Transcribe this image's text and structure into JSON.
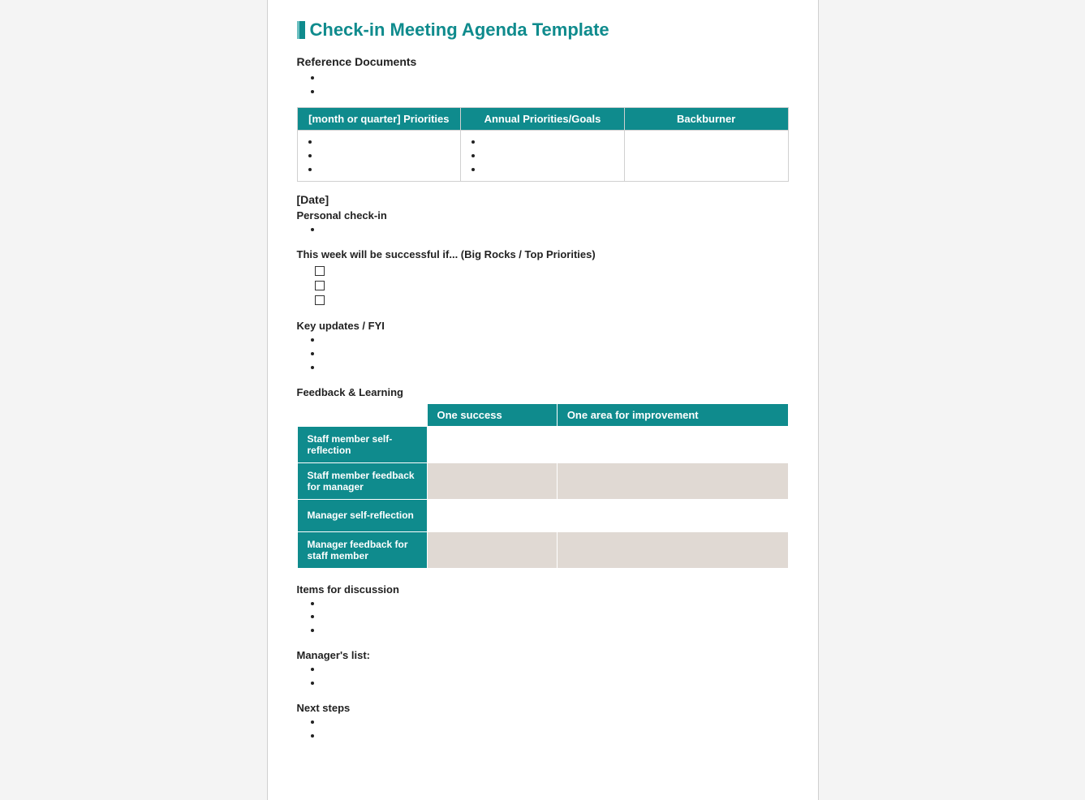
{
  "title": "Check-in Meeting Agenda Template",
  "sections": {
    "reference_docs": "Reference Documents",
    "date": "[Date]",
    "personal_checkin": "Personal check-in",
    "successful_if": "This week will be successful if... (Big Rocks / Top Priorities)",
    "key_updates": "Key updates / FYI",
    "feedback_learning": "Feedback & Learning",
    "items_discussion": "Items for discussion",
    "managers_list": "Manager's list:",
    "next_steps": "Next steps"
  },
  "priorities_table": {
    "headers": [
      "[month or quarter] Priorities",
      "Annual Priorities/Goals",
      "Backburner"
    ]
  },
  "feedback_table": {
    "col_headers": [
      "One success",
      "One area for improvement"
    ],
    "row_headers": [
      "Staff member self-reflection",
      "Staff member feedback for manager",
      "Manager self-reflection",
      "Manager feedback for staff member"
    ]
  }
}
